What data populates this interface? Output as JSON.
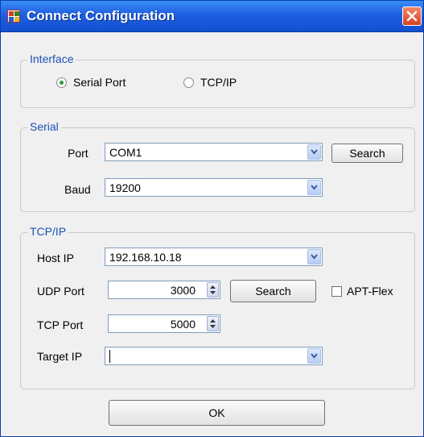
{
  "window": {
    "title": "Connect Configuration"
  },
  "icons": {
    "app": "app-icon",
    "close": "close-icon",
    "dropdown": "chevron-down-icon",
    "spinner": "spinner-arrows-icon"
  },
  "interface": {
    "legend": "Interface",
    "options": [
      "Serial Port",
      "TCP/IP"
    ],
    "selected": "Serial Port"
  },
  "serial": {
    "legend": "Serial",
    "port_label": "Port",
    "port_value": "COM1",
    "search_label": "Search",
    "baud_label": "Baud",
    "baud_value": "19200"
  },
  "tcpip": {
    "legend": "TCP/IP",
    "host_ip_label": "Host IP",
    "host_ip_value": "192.168.10.18",
    "udp_port_label": "UDP Port",
    "udp_port_value": "3000",
    "search_label": "Search",
    "apt_flex_label": "APT-Flex",
    "apt_flex_checked": false,
    "tcp_port_label": "TCP Port",
    "tcp_port_value": "5000",
    "target_ip_label": "Target IP",
    "target_ip_value": ""
  },
  "ok_label": "OK",
  "colors": {
    "title_bar": "#1e5fe0",
    "legend_text": "#1a50b8",
    "close_button": "#d8401e"
  }
}
